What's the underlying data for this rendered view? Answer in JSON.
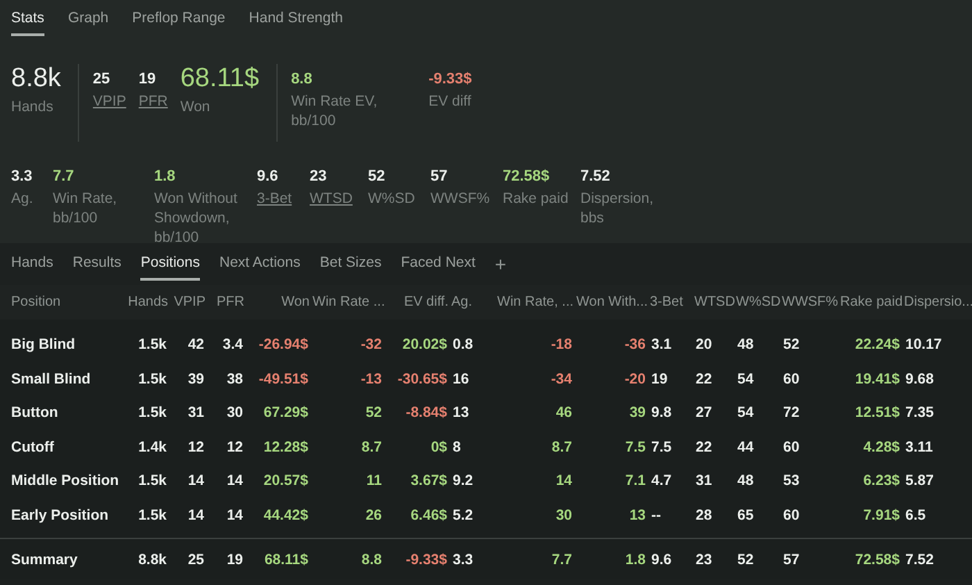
{
  "top_tabs": [
    {
      "label": "Stats",
      "selected": true
    },
    {
      "label": "Graph",
      "selected": false
    },
    {
      "label": "Preflop Range",
      "selected": false
    },
    {
      "label": "Hand Strength",
      "selected": false
    }
  ],
  "summary_groups": [
    [
      {
        "kind": "headline",
        "value": "8.8k",
        "label": "Hands",
        "color": "#ecefec",
        "underlined": false
      }
    ],
    [
      {
        "kind": "compact",
        "value": "25",
        "label": "VPIP",
        "color": "#ecefec",
        "underlined": true
      },
      {
        "kind": "compact",
        "value": "19",
        "label": "PFR",
        "color": "#ecefec",
        "underlined": true
      },
      {
        "kind": "headline",
        "value": "68.11$",
        "label": "Won",
        "color": "#a6d77f",
        "underlined": false
      }
    ],
    [
      {
        "kind": "compact",
        "value": "8.8",
        "label": "Win Rate EV, bb/100",
        "color": "#a6d77f",
        "underlined": false
      },
      {
        "kind": "compact",
        "value": "-9.33$",
        "label": "EV diff",
        "color": "#e5806f",
        "underlined": false
      }
    ]
  ],
  "detail_stats": [
    {
      "value": "3.3",
      "label": "Ag.",
      "color": "#ecefec",
      "underlined": false
    },
    {
      "value": "7.7",
      "label": "Win Rate, bb/100",
      "color": "#a6d77f",
      "underlined": false
    },
    {
      "value": "1.8",
      "label": "Won Without Showdown, bb/100",
      "color": "#a6d77f",
      "underlined": false
    },
    {
      "value": "9.6",
      "label": "3-Bet",
      "color": "#ecefec",
      "underlined": true
    },
    {
      "value": "23",
      "label": "WTSD",
      "color": "#ecefec",
      "underlined": true
    },
    {
      "value": "52",
      "label": "W%SD",
      "color": "#ecefec",
      "underlined": false
    },
    {
      "value": "57",
      "label": "WWSF%",
      "color": "#ecefec",
      "underlined": false
    },
    {
      "value": "72.58$",
      "label": "Rake paid",
      "color": "#a6d77f",
      "underlined": false
    },
    {
      "value": "7.52",
      "label": "Dispersion, bbs",
      "color": "#ecefec",
      "underlined": false
    }
  ],
  "bottom_tabs": [
    {
      "label": "Hands",
      "selected": false
    },
    {
      "label": "Results",
      "selected": false
    },
    {
      "label": "Positions",
      "selected": true
    },
    {
      "label": "Next Actions",
      "selected": false
    },
    {
      "label": "Bet Sizes",
      "selected": false
    },
    {
      "label": "Faced Next",
      "selected": false
    }
  ],
  "add_tab": "+",
  "table": {
    "columns": [
      "Position",
      "Hands",
      "VPIP",
      "PFR",
      "Won",
      "Win Rate ...",
      "EV diff.",
      "Ag.",
      "Win Rate, ...",
      "Won With...",
      "3-Bet",
      "WTSD",
      "W%SD",
      "WWSF%",
      "Rake paid",
      "Dispersio..."
    ],
    "rows": [
      {
        "cells": [
          {
            "text": "Big Blind",
            "color": "#ecefec"
          },
          {
            "text": "1.5k",
            "color": "#ecefec"
          },
          {
            "text": "42",
            "color": "#ecefec"
          },
          {
            "text": "3.4",
            "color": "#ecefec"
          },
          {
            "text": "-26.94$",
            "color": "#e5806f"
          },
          {
            "text": "-32",
            "color": "#e5806f"
          },
          {
            "text": "20.02$",
            "color": "#a6d77f"
          },
          {
            "text": "0.8",
            "color": "#ecefec"
          },
          {
            "text": "-18",
            "color": "#e5806f"
          },
          {
            "text": "-36",
            "color": "#e5806f"
          },
          {
            "text": "3.1",
            "color": "#ecefec"
          },
          {
            "text": "20",
            "color": "#ecefec"
          },
          {
            "text": "48",
            "color": "#ecefec"
          },
          {
            "text": "52",
            "color": "#ecefec"
          },
          {
            "text": "22.24$",
            "color": "#a6d77f"
          },
          {
            "text": "10.17",
            "color": "#ecefec"
          }
        ]
      },
      {
        "cells": [
          {
            "text": "Small Blind",
            "color": "#ecefec"
          },
          {
            "text": "1.5k",
            "color": "#ecefec"
          },
          {
            "text": "39",
            "color": "#ecefec"
          },
          {
            "text": "38",
            "color": "#ecefec"
          },
          {
            "text": "-49.51$",
            "color": "#e5806f"
          },
          {
            "text": "-13",
            "color": "#e5806f"
          },
          {
            "text": "-30.65$",
            "color": "#e5806f"
          },
          {
            "text": "16",
            "color": "#ecefec"
          },
          {
            "text": "-34",
            "color": "#e5806f"
          },
          {
            "text": "-20",
            "color": "#e5806f"
          },
          {
            "text": "19",
            "color": "#ecefec"
          },
          {
            "text": "22",
            "color": "#ecefec"
          },
          {
            "text": "54",
            "color": "#ecefec"
          },
          {
            "text": "60",
            "color": "#ecefec"
          },
          {
            "text": "19.41$",
            "color": "#a6d77f"
          },
          {
            "text": "9.68",
            "color": "#ecefec"
          }
        ]
      },
      {
        "cells": [
          {
            "text": "Button",
            "color": "#ecefec"
          },
          {
            "text": "1.5k",
            "color": "#ecefec"
          },
          {
            "text": "31",
            "color": "#ecefec"
          },
          {
            "text": "30",
            "color": "#ecefec"
          },
          {
            "text": "67.29$",
            "color": "#a6d77f"
          },
          {
            "text": "52",
            "color": "#a6d77f"
          },
          {
            "text": "-8.84$",
            "color": "#e5806f"
          },
          {
            "text": "13",
            "color": "#ecefec"
          },
          {
            "text": "46",
            "color": "#a6d77f"
          },
          {
            "text": "39",
            "color": "#a6d77f"
          },
          {
            "text": "9.8",
            "color": "#ecefec"
          },
          {
            "text": "27",
            "color": "#ecefec"
          },
          {
            "text": "54",
            "color": "#ecefec"
          },
          {
            "text": "72",
            "color": "#ecefec"
          },
          {
            "text": "12.51$",
            "color": "#a6d77f"
          },
          {
            "text": "7.35",
            "color": "#ecefec"
          }
        ]
      },
      {
        "cells": [
          {
            "text": "Cutoff",
            "color": "#ecefec"
          },
          {
            "text": "1.4k",
            "color": "#ecefec"
          },
          {
            "text": "12",
            "color": "#ecefec"
          },
          {
            "text": "12",
            "color": "#ecefec"
          },
          {
            "text": "12.28$",
            "color": "#a6d77f"
          },
          {
            "text": "8.7",
            "color": "#a6d77f"
          },
          {
            "text": "0$",
            "color": "#a6d77f"
          },
          {
            "text": "8",
            "color": "#ecefec"
          },
          {
            "text": "8.7",
            "color": "#a6d77f"
          },
          {
            "text": "7.5",
            "color": "#a6d77f"
          },
          {
            "text": "7.5",
            "color": "#ecefec"
          },
          {
            "text": "22",
            "color": "#ecefec"
          },
          {
            "text": "44",
            "color": "#ecefec"
          },
          {
            "text": "60",
            "color": "#ecefec"
          },
          {
            "text": "4.28$",
            "color": "#a6d77f"
          },
          {
            "text": "3.11",
            "color": "#ecefec"
          }
        ]
      },
      {
        "cells": [
          {
            "text": "Middle Position",
            "color": "#ecefec"
          },
          {
            "text": "1.5k",
            "color": "#ecefec"
          },
          {
            "text": "14",
            "color": "#ecefec"
          },
          {
            "text": "14",
            "color": "#ecefec"
          },
          {
            "text": "20.57$",
            "color": "#a6d77f"
          },
          {
            "text": "11",
            "color": "#a6d77f"
          },
          {
            "text": "3.67$",
            "color": "#a6d77f"
          },
          {
            "text": "9.2",
            "color": "#ecefec"
          },
          {
            "text": "14",
            "color": "#a6d77f"
          },
          {
            "text": "7.1",
            "color": "#a6d77f"
          },
          {
            "text": "4.7",
            "color": "#ecefec"
          },
          {
            "text": "31",
            "color": "#ecefec"
          },
          {
            "text": "48",
            "color": "#ecefec"
          },
          {
            "text": "53",
            "color": "#ecefec"
          },
          {
            "text": "6.23$",
            "color": "#a6d77f"
          },
          {
            "text": "5.87",
            "color": "#ecefec"
          }
        ]
      },
      {
        "cells": [
          {
            "text": "Early Position",
            "color": "#ecefec"
          },
          {
            "text": "1.5k",
            "color": "#ecefec"
          },
          {
            "text": "14",
            "color": "#ecefec"
          },
          {
            "text": "14",
            "color": "#ecefec"
          },
          {
            "text": "44.42$",
            "color": "#a6d77f"
          },
          {
            "text": "26",
            "color": "#a6d77f"
          },
          {
            "text": "6.46$",
            "color": "#a6d77f"
          },
          {
            "text": "5.2",
            "color": "#ecefec"
          },
          {
            "text": "30",
            "color": "#a6d77f"
          },
          {
            "text": "13",
            "color": "#a6d77f"
          },
          {
            "text": "--",
            "color": "#ecefec"
          },
          {
            "text": "28",
            "color": "#ecefec"
          },
          {
            "text": "65",
            "color": "#ecefec"
          },
          {
            "text": "60",
            "color": "#ecefec"
          },
          {
            "text": "7.91$",
            "color": "#a6d77f"
          },
          {
            "text": "6.5",
            "color": "#ecefec"
          }
        ]
      }
    ],
    "summary": {
      "cells": [
        {
          "text": "Summary",
          "color": "#ecefec"
        },
        {
          "text": "8.8k",
          "color": "#ecefec"
        },
        {
          "text": "25",
          "color": "#ecefec"
        },
        {
          "text": "19",
          "color": "#ecefec"
        },
        {
          "text": "68.11$",
          "color": "#a6d77f"
        },
        {
          "text": "8.8",
          "color": "#a6d77f"
        },
        {
          "text": "-9.33$",
          "color": "#e5806f"
        },
        {
          "text": "3.3",
          "color": "#ecefec"
        },
        {
          "text": "7.7",
          "color": "#a6d77f"
        },
        {
          "text": "1.8",
          "color": "#a6d77f"
        },
        {
          "text": "9.6",
          "color": "#ecefec"
        },
        {
          "text": "23",
          "color": "#ecefec"
        },
        {
          "text": "52",
          "color": "#ecefec"
        },
        {
          "text": "57",
          "color": "#ecefec"
        },
        {
          "text": "72.58$",
          "color": "#a6d77f"
        },
        {
          "text": "7.52",
          "color": "#ecefec"
        }
      ]
    }
  }
}
